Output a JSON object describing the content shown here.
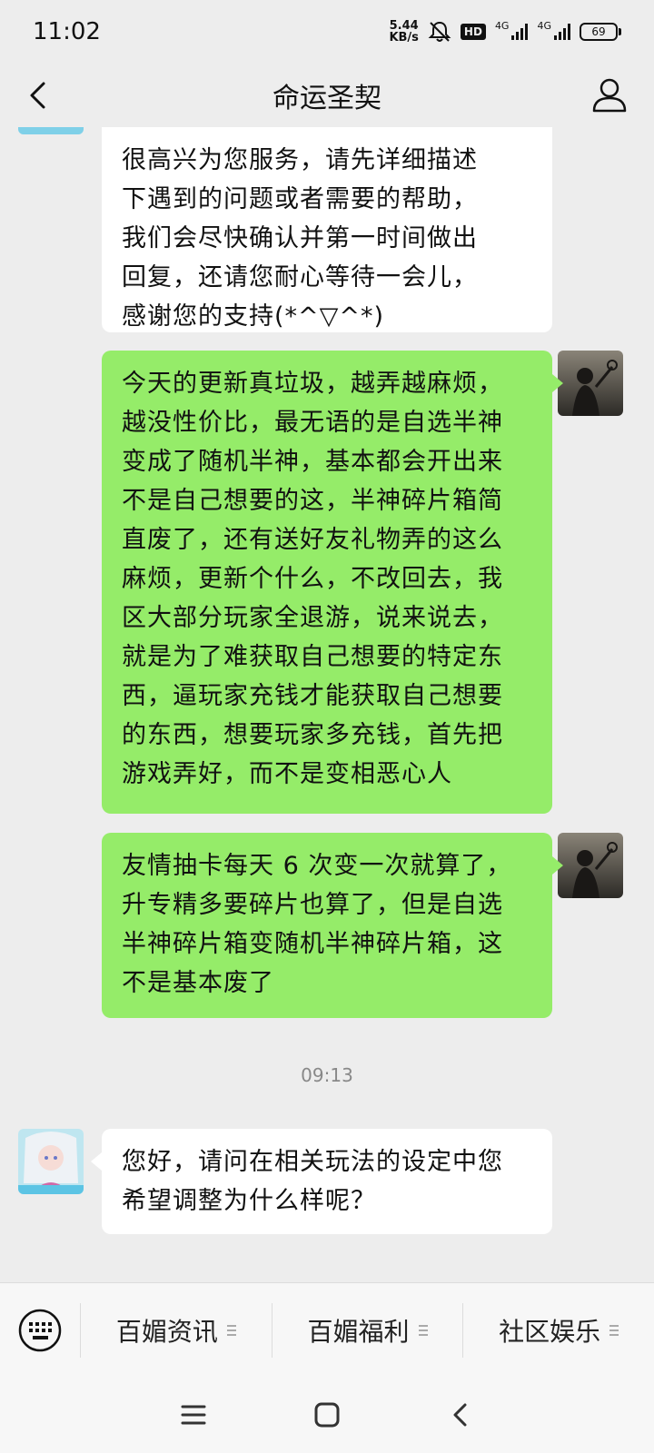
{
  "status_bar": {
    "time": "11:02",
    "speed_value": "5.44",
    "speed_unit": "KB/s",
    "hd_label": "HD",
    "net1": "4G",
    "net2": "4G",
    "battery": "69"
  },
  "header": {
    "title": "命运圣契"
  },
  "messages": [
    {
      "side": "left",
      "text": "很高兴为您服务，请先详细描述\n下遇到的问题或者需要的帮助，\n我们会尽快确认并第一时间做出\n回复，还请您耐心等待一会儿，\n感谢您的支持(*^▽^*)"
    },
    {
      "side": "right",
      "text": "今天的更新真垃圾，越弄越麻烦，\n越没性价比，最无语的是自选半神\n变成了随机半神，基本都会开出来\n不是自己想要的这，半神碎片箱简\n直废了，还有送好友礼物弄的这么\n麻烦，更新个什么，不改回去，我\n区大部分玩家全退游，说来说去，\n就是为了难获取自己想要的特定东\n西，逼玩家充钱才能获取自己想要\n的东西，想要玩家多充钱，首先把\n游戏弄好，而不是变相恶心人"
    },
    {
      "side": "right",
      "text": "友情抽卡每天 6 次变一次就算了，\n升专精多要碎片也算了，但是自选\n半神碎片箱变随机半神碎片箱，这\n不是基本废了"
    },
    {
      "side": "left",
      "text": "您好，请问在相关玩法的设定中您\n希望调整为什么样呢？"
    }
  ],
  "timestamp": "09:13",
  "menu": {
    "items": [
      "百媚资讯",
      "百媚福利",
      "社区娱乐"
    ]
  },
  "colors": {
    "background": "#ededed",
    "bubble_self": "#95ec69",
    "bubble_other": "#ffffff"
  },
  "icons": {
    "back": "chevron-left-icon",
    "profile": "user-icon",
    "keyboard": "keyboard-icon",
    "mute": "bell-off-icon"
  }
}
